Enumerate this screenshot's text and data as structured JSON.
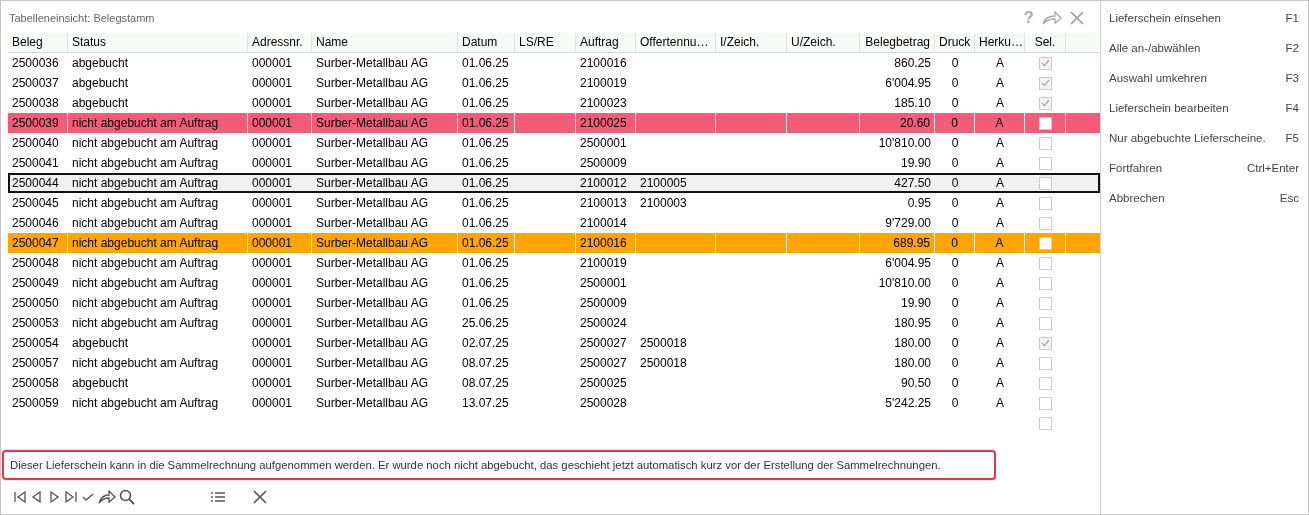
{
  "window": {
    "title": "Tabelleneinsicht: Belegstamm",
    "controls": [
      "?"
    ]
  },
  "table": {
    "columns": [
      "Beleg",
      "Status",
      "Adressnr.",
      "Name",
      "Datum",
      "LS/RE",
      "Auftrag",
      "Offertennu…",
      "I/Zeich.",
      "U/Zeich.",
      "Belegbetrag",
      "Druck",
      "Herku…",
      "Sel."
    ],
    "rows": [
      {
        "cells": [
          "2500036",
          "abgebucht",
          "000001",
          "Surber-Metallbau AG",
          "01.06.25",
          "",
          "2100016",
          "",
          "",
          "",
          "860.25",
          "0",
          "A"
        ],
        "checked": true,
        "focused": false
      },
      {
        "cells": [
          "2500037",
          "abgebucht",
          "000001",
          "Surber-Metallbau AG",
          "01.06.25",
          "",
          "2100019",
          "",
          "",
          "",
          "6'004.95",
          "0",
          "A"
        ],
        "checked": true,
        "focused": false
      },
      {
        "cells": [
          "2500038",
          "abgebucht",
          "000001",
          "Surber-Metallbau AG",
          "01.06.25",
          "",
          "2100023",
          "",
          "",
          "",
          "185.10",
          "0",
          "A"
        ],
        "checked": true,
        "focused": false
      },
      {
        "cells": [
          "2500039",
          "nicht abgebucht am Auftrag",
          "000001",
          "Surber-Metallbau AG",
          "01.06.25",
          "",
          "2100025",
          "",
          "",
          "",
          "20.60",
          "0",
          "A"
        ],
        "checked": false,
        "focused": false,
        "color": "#f25c78"
      },
      {
        "cells": [
          "2500040",
          "nicht abgebucht am Auftrag",
          "000001",
          "Surber-Metallbau AG",
          "01.06.25",
          "",
          "2500001",
          "",
          "",
          "",
          "10'810.00",
          "0",
          "A"
        ],
        "checked": false,
        "focused": false
      },
      {
        "cells": [
          "2500041",
          "nicht abgebucht am Auftrag",
          "000001",
          "Surber-Metallbau AG",
          "01.06.25",
          "",
          "2500009",
          "",
          "",
          "",
          "19.90",
          "0",
          "A"
        ],
        "checked": false,
        "focused": false
      },
      {
        "cells": [
          "2500044",
          "nicht abgebucht am Auftrag",
          "000001",
          "Surber-Metallbau AG",
          "01.06.25",
          "",
          "2100012",
          "2100005",
          "",
          "",
          "427.50",
          "0",
          "A"
        ],
        "checked": false,
        "focused": true
      },
      {
        "cells": [
          "2500045",
          "nicht abgebucht am Auftrag",
          "000001",
          "Surber-Metallbau AG",
          "01.06.25",
          "",
          "2100013",
          "2100003",
          "",
          "",
          "0.95",
          "0",
          "A"
        ],
        "checked": false,
        "focused": false
      },
      {
        "cells": [
          "2500046",
          "nicht abgebucht am Auftrag",
          "000001",
          "Surber-Metallbau AG",
          "01.06.25",
          "",
          "2100014",
          "",
          "",
          "",
          "9'729.00",
          "0",
          "A"
        ],
        "checked": false,
        "focused": false
      },
      {
        "cells": [
          "2500047",
          "nicht abgebucht am Auftrag",
          "000001",
          "Surber-Metallbau AG",
          "01.06.25",
          "",
          "2100016",
          "",
          "",
          "",
          "689.95",
          "0",
          "A"
        ],
        "checked": false,
        "focused": false,
        "color": "#ffa500"
      },
      {
        "cells": [
          "2500048",
          "nicht abgebucht am Auftrag",
          "000001",
          "Surber-Metallbau AG",
          "01.06.25",
          "",
          "2100019",
          "",
          "",
          "",
          "6'004.95",
          "0",
          "A"
        ],
        "checked": false,
        "focused": false
      },
      {
        "cells": [
          "2500049",
          "nicht abgebucht am Auftrag",
          "000001",
          "Surber-Metallbau AG",
          "01.06.25",
          "",
          "2500001",
          "",
          "",
          "",
          "10'810.00",
          "0",
          "A"
        ],
        "checked": false,
        "focused": false
      },
      {
        "cells": [
          "2500050",
          "nicht abgebucht am Auftrag",
          "000001",
          "Surber-Metallbau AG",
          "01.06.25",
          "",
          "2500009",
          "",
          "",
          "",
          "19.90",
          "0",
          "A"
        ],
        "checked": false,
        "focused": false
      },
      {
        "cells": [
          "2500053",
          "nicht abgebucht am Auftrag",
          "000001",
          "Surber-Metallbau AG",
          "25.06.25",
          "",
          "2500024",
          "",
          "",
          "",
          "180.95",
          "0",
          "A"
        ],
        "checked": false,
        "focused": false
      },
      {
        "cells": [
          "2500054",
          "abgebucht",
          "000001",
          "Surber-Metallbau AG",
          "02.07.25",
          "",
          "2500027",
          "2500018",
          "",
          "",
          "180.00",
          "0",
          "A"
        ],
        "checked": true,
        "focused": false
      },
      {
        "cells": [
          "2500057",
          "nicht abgebucht am Auftrag",
          "000001",
          "Surber-Metallbau AG",
          "08.07.25",
          "",
          "2500027",
          "2500018",
          "",
          "",
          "180.00",
          "0",
          "A"
        ],
        "checked": false,
        "focused": false
      },
      {
        "cells": [
          "2500058",
          "abgebucht",
          "000001",
          "Surber-Metallbau AG",
          "08.07.25",
          "",
          "2500025",
          "",
          "",
          "",
          "90.50",
          "0",
          "A"
        ],
        "checked": false,
        "focused": false
      },
      {
        "cells": [
          "2500059",
          "nicht abgebucht am Auftrag",
          "000001",
          "Surber-Metallbau AG",
          "13.07.25",
          "",
          "2500028",
          "",
          "",
          "",
          "5'242.25",
          "0",
          "A"
        ],
        "checked": false,
        "focused": false
      },
      {
        "checked": false,
        "focused": false
      }
    ]
  },
  "message": "Dieser Lieferschein kann in die Sammelrechnung aufgenommen werden. Er wurde noch nicht abgebucht, das geschieht jetzt automatisch kurz vor der Erstellung der Sammelrechnungen.",
  "sidebar": {
    "items": [
      {
        "label": "Lieferschein einsehen",
        "shortcut": "F1"
      },
      {
        "label": "Alle an-/abwählen",
        "shortcut": "F2"
      },
      {
        "label": "Auswahl umkehren",
        "shortcut": "F3"
      },
      {
        "label": "Lieferschein bearbeiten",
        "shortcut": "F4"
      },
      {
        "label": "Nur abgebuchte Lieferscheine.",
        "shortcut": "F5"
      },
      {
        "label": "Fortfahren",
        "shortcut": "Ctrl+Enter"
      },
      {
        "label": "Abbrechen",
        "shortcut": "Esc"
      }
    ]
  }
}
